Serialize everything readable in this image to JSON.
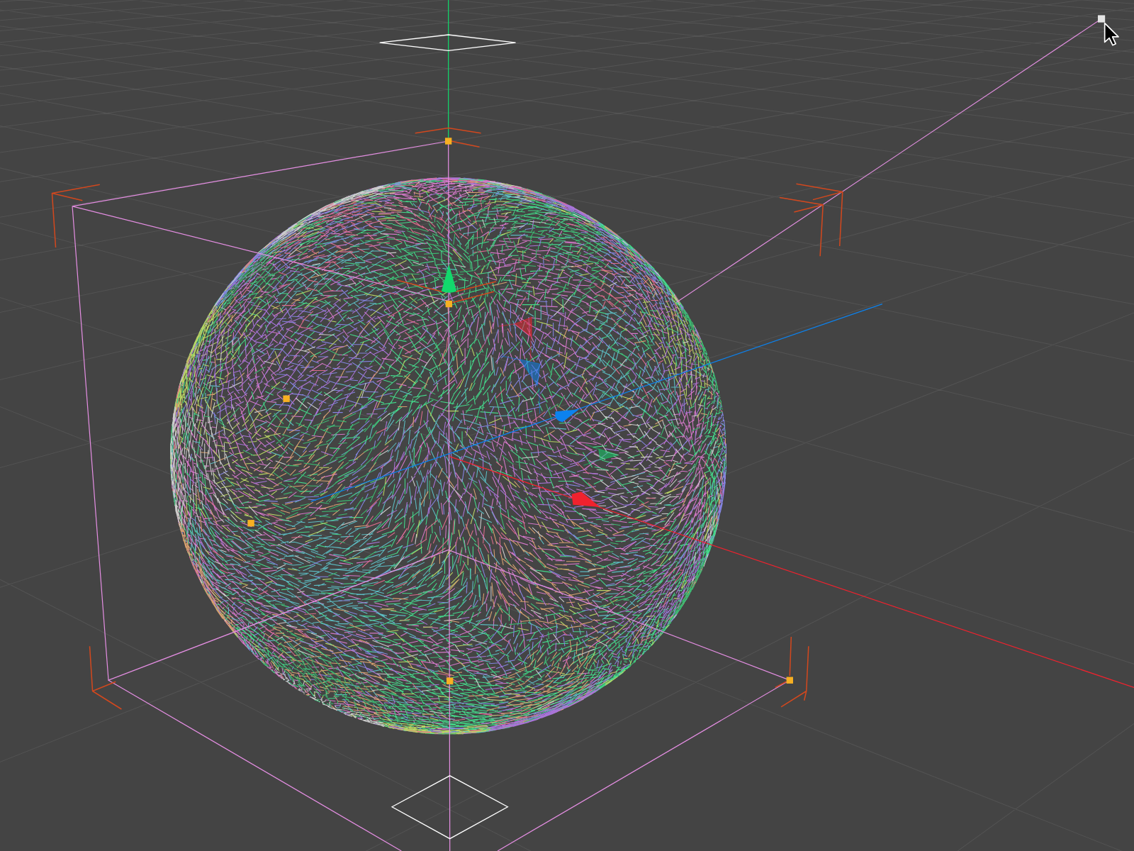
{
  "viewport": {
    "gizmo_axes": [
      {
        "kind": "y",
        "color": "#12d86c"
      },
      {
        "kind": "z",
        "color": "#0c82ee"
      },
      {
        "kind": "x",
        "color": "#f0222e"
      }
    ]
  }
}
